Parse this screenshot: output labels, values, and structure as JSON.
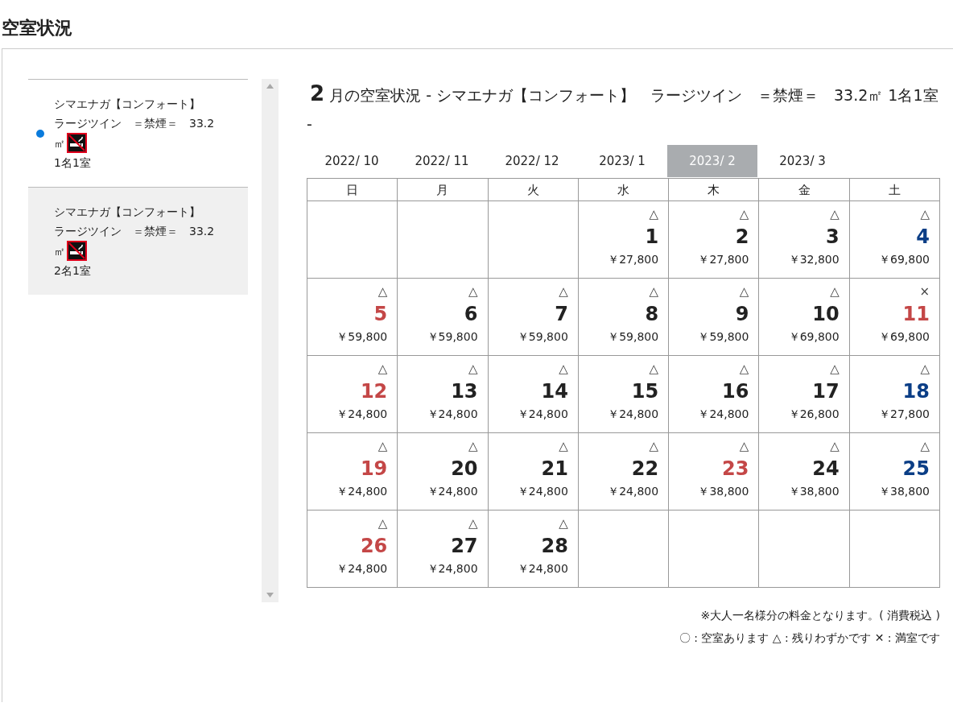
{
  "page_title": "空室状況",
  "rooms": [
    {
      "name_lines": [
        "シマエナガ【コンフォート】",
        "ラージツイン　＝禁煙＝　33.2",
        "㎡"
      ],
      "non_smoking": true,
      "occupancy": "1名1室",
      "selected": true
    },
    {
      "name_lines": [
        "シマエナガ【コンフォート】",
        "ラージツイン　＝禁煙＝　33.2",
        "㎡"
      ],
      "non_smoking": true,
      "occupancy": "2名1室",
      "selected": false
    }
  ],
  "heading": {
    "month": "2",
    "text": "月の空室状況 - シマエナガ【コンフォート】　ラージツイン　＝禁煙＝　33.2㎡ 1名1室 -"
  },
  "month_tabs": [
    {
      "label": "2022/ 10",
      "selected": false
    },
    {
      "label": "2022/ 11",
      "selected": false
    },
    {
      "label": "2022/ 12",
      "selected": false
    },
    {
      "label": "2023/ 1",
      "selected": false
    },
    {
      "label": "2023/ 2",
      "selected": true
    },
    {
      "label": "2023/ 3",
      "selected": false
    }
  ],
  "weekdays": [
    {
      "label": "日"
    },
    {
      "label": "月"
    },
    {
      "label": "火"
    },
    {
      "label": "水"
    },
    {
      "label": "木"
    },
    {
      "label": "金"
    },
    {
      "label": "土"
    }
  ],
  "weeks": [
    [
      {
        "kind": "empty"
      },
      {
        "kind": "empty"
      },
      {
        "kind": "empty"
      },
      {
        "kind": "weekday",
        "mark": "△",
        "day": "1",
        "price": "￥27,800"
      },
      {
        "kind": "weekday",
        "mark": "△",
        "day": "2",
        "price": "￥27,800"
      },
      {
        "kind": "weekday",
        "mark": "△",
        "day": "3",
        "price": "￥32,800"
      },
      {
        "kind": "saturday",
        "mark": "△",
        "day": "4",
        "price": "￥69,800"
      }
    ],
    [
      {
        "kind": "holiday",
        "mark": "△",
        "day": "5",
        "price": "￥59,800"
      },
      {
        "kind": "weekday",
        "mark": "△",
        "day": "6",
        "price": "￥59,800"
      },
      {
        "kind": "weekday",
        "mark": "△",
        "day": "7",
        "price": "￥59,800"
      },
      {
        "kind": "weekday",
        "mark": "△",
        "day": "8",
        "price": "￥59,800"
      },
      {
        "kind": "weekday",
        "mark": "△",
        "day": "9",
        "price": "￥59,800"
      },
      {
        "kind": "weekday",
        "mark": "△",
        "day": "10",
        "price": "￥69,800"
      },
      {
        "kind": "holiday",
        "mark": "×",
        "day": "11",
        "price": "￥69,800"
      }
    ],
    [
      {
        "kind": "holiday",
        "mark": "△",
        "day": "12",
        "price": "￥24,800"
      },
      {
        "kind": "weekday",
        "mark": "△",
        "day": "13",
        "price": "￥24,800"
      },
      {
        "kind": "weekday",
        "mark": "△",
        "day": "14",
        "price": "￥24,800"
      },
      {
        "kind": "weekday",
        "mark": "△",
        "day": "15",
        "price": "￥24,800"
      },
      {
        "kind": "weekday",
        "mark": "△",
        "day": "16",
        "price": "￥24,800"
      },
      {
        "kind": "weekday",
        "mark": "△",
        "day": "17",
        "price": "￥26,800"
      },
      {
        "kind": "saturday",
        "mark": "△",
        "day": "18",
        "price": "￥27,800"
      }
    ],
    [
      {
        "kind": "holiday",
        "mark": "△",
        "day": "19",
        "price": "￥24,800"
      },
      {
        "kind": "weekday",
        "mark": "△",
        "day": "20",
        "price": "￥24,800"
      },
      {
        "kind": "weekday",
        "mark": "△",
        "day": "21",
        "price": "￥24,800"
      },
      {
        "kind": "weekday",
        "mark": "△",
        "day": "22",
        "price": "￥24,800"
      },
      {
        "kind": "holiday",
        "mark": "△",
        "day": "23",
        "price": "￥38,800"
      },
      {
        "kind": "weekday",
        "mark": "△",
        "day": "24",
        "price": "￥38,800"
      },
      {
        "kind": "saturday",
        "mark": "△",
        "day": "25",
        "price": "￥38,800"
      }
    ],
    [
      {
        "kind": "holiday",
        "mark": "△",
        "day": "26",
        "price": "￥24,800"
      },
      {
        "kind": "weekday",
        "mark": "△",
        "day": "27",
        "price": "￥24,800"
      },
      {
        "kind": "weekday",
        "mark": "△",
        "day": "28",
        "price": "￥24,800"
      },
      {
        "kind": "empty"
      },
      {
        "kind": "empty"
      },
      {
        "kind": "empty"
      },
      {
        "kind": "empty"
      }
    ]
  ],
  "notes": [
    "※大人一名様分の料金となります。( 消費税込 )",
    "〇 : 空室あります △ : 残りわずかです ✕ : 満室です"
  ]
}
